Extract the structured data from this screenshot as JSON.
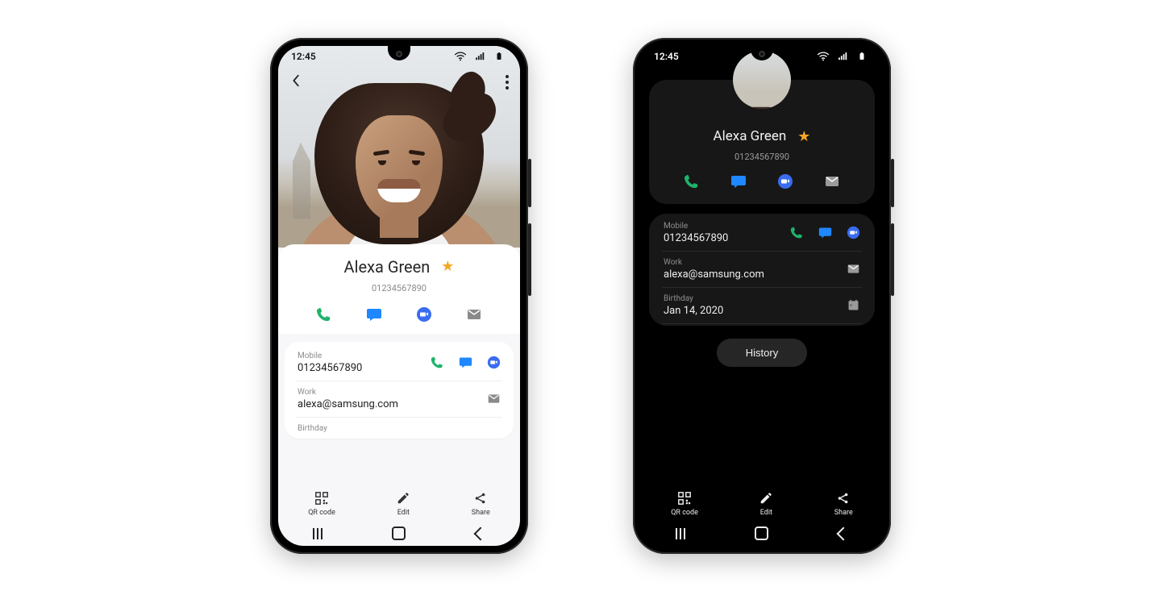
{
  "status": {
    "time": "12:45"
  },
  "contact": {
    "name": "Alexa Green",
    "primary_number": "01234567890"
  },
  "fields": {
    "mobile": {
      "label": "Mobile",
      "value": "01234567890"
    },
    "work": {
      "label": "Work",
      "value": "alexa@samsung.com"
    },
    "birthday": {
      "label": "Birthday",
      "value": "Jan 14, 2020"
    }
  },
  "buttons": {
    "history": "History"
  },
  "actionbar": {
    "qr": "QR code",
    "edit": "Edit",
    "share": "Share"
  },
  "icons": {
    "back": "chevron-left",
    "more": "more-vertical",
    "favorite": "star",
    "call": "phone",
    "message": "chat-bubble",
    "video": "video-call",
    "email": "envelope",
    "calendar": "calendar",
    "qr": "qr-code",
    "edit": "pencil",
    "share": "share",
    "wifi": "wifi",
    "signal": "cell-signal",
    "battery": "battery-full",
    "nav_recents": "recents",
    "nav_home": "home",
    "nav_back": "back"
  },
  "colors": {
    "call": "#1fb36b",
    "message": "#1f87ff",
    "video": "#3a6cf0",
    "mail": "#8a8a8a",
    "star": "#f6a623"
  }
}
